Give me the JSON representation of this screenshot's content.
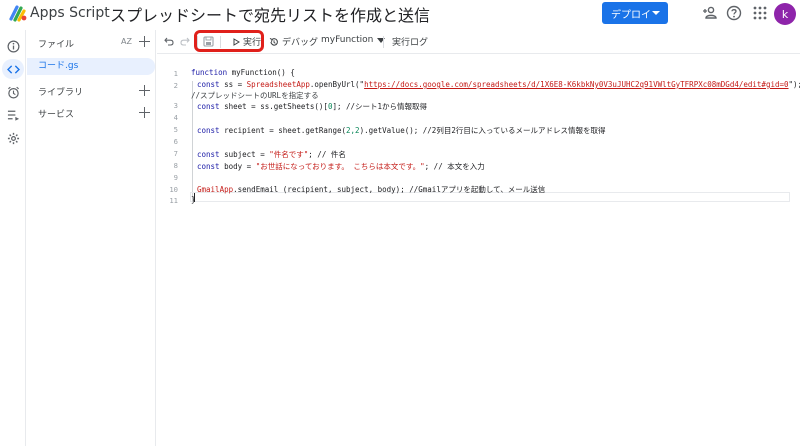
{
  "header": {
    "app_name": "Apps Script",
    "project_title": "スプレッドシートで宛先リストを作成と送信",
    "deploy_label": "デプロイ",
    "avatar_letter": "k",
    "accent": "#1a73e8"
  },
  "rail": {
    "items": [
      {
        "name": "overview",
        "icon": "info-icon"
      },
      {
        "name": "editor",
        "icon": "code-icon",
        "active": true
      },
      {
        "name": "triggers",
        "icon": "alarm-icon"
      },
      {
        "name": "executions",
        "icon": "executions-icon"
      },
      {
        "name": "settings",
        "icon": "gear-icon"
      }
    ]
  },
  "files": {
    "title": "ファイル",
    "sort_label": "AZ",
    "items": [
      {
        "label": "コード.gs",
        "selected": true
      }
    ],
    "sections": [
      {
        "label": "ライブラリ"
      },
      {
        "label": "サービス"
      }
    ]
  },
  "toolbar": {
    "run_label": "実行",
    "debug_label": "デバッグ",
    "function_name": "myFunction",
    "log_label": "実行ログ",
    "highlight_color": "#e0201b"
  },
  "editor": {
    "line_numbers": [
      "1",
      "2",
      "3",
      "4",
      "5",
      "6",
      "7",
      "8",
      "9",
      "10",
      "11"
    ],
    "lines": {
      "l1a": "function",
      "l1b": " myFunction() {",
      "l2a": "const",
      "l2b": " ss = ",
      "l2c": "SpreadsheetApp",
      "l2d": ".openByUrl(\"",
      "l2e": "https://docs.google.com/spreadsheets/d/1X6E8-K6kbkNy0V3uJUHC2q91VWltGyTFRPXc08mDGd4/edit#gid=0",
      "l2f": "\");",
      "l2g": "//スプレッドシートのURLを指定する",
      "l3a": "const",
      "l3b": " sheet = ss.getSheets()[",
      "l3c": "0",
      "l3d": "]; //シート1から情報取得",
      "l5a": "const",
      "l5b": " recipient = sheet.getRange(",
      "l5c": "2,2",
      "l5d": ").getValue(); //2列目2行目に入っているメールアドレス情報を取得",
      "l7a": "const",
      "l7b": " subject = ",
      "l7c": "\"件名です\"",
      "l7d": "; // 件名",
      "l8a": "const",
      "l8b": " body = ",
      "l8c": "\"お世話になっております。 こちらは本文です。\"",
      "l8d": "; // 本文を入力",
      "l10a": "GmailApp",
      "l10b": ".sendEmail (recipient, subject, body); //Gmailアプリを起動して、メール送信",
      "l11": "}"
    }
  }
}
